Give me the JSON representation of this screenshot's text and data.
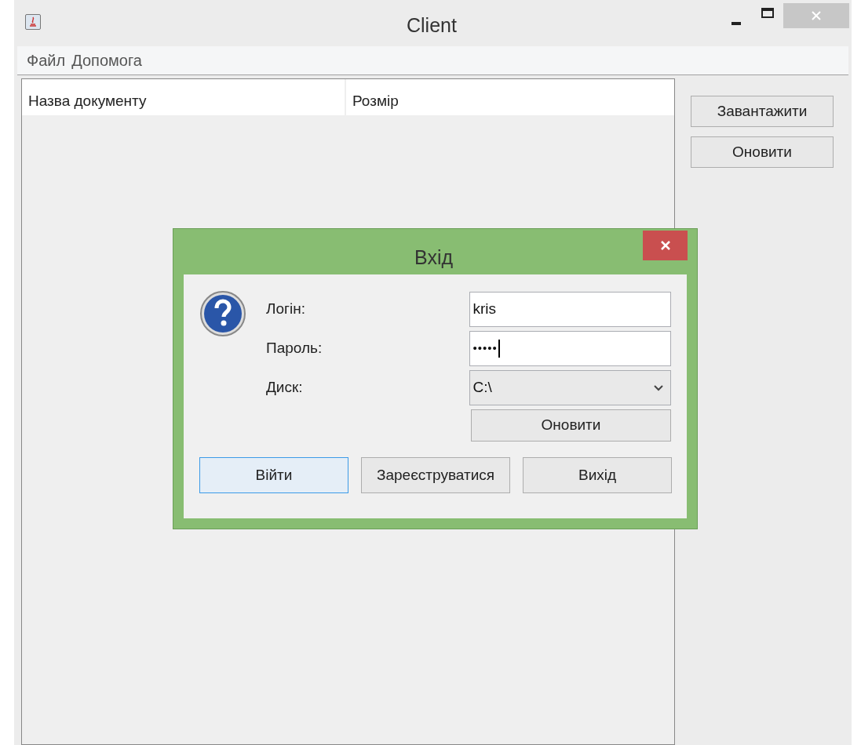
{
  "window": {
    "title": "Client"
  },
  "menu": [
    "Файл",
    "Допомога"
  ],
  "table": {
    "columns": [
      "Назва документу",
      "Розмір"
    ]
  },
  "side_buttons": [
    "Завантажити",
    "Оновити"
  ],
  "dialog": {
    "title": "Вхід",
    "fields": [
      {
        "kind": "text",
        "label": "Логін:",
        "value": "kris"
      },
      {
        "kind": "password",
        "label": "Пароль:",
        "value": "•••••"
      },
      {
        "kind": "combo",
        "label": "Диск:",
        "value": "C:\\"
      }
    ],
    "refresh_button": "Оновити",
    "buttons": [
      {
        "label": "Війти",
        "focused": true
      },
      {
        "label": "Зареєструватися",
        "focused": false
      },
      {
        "label": "Вихід",
        "focused": false
      }
    ]
  }
}
